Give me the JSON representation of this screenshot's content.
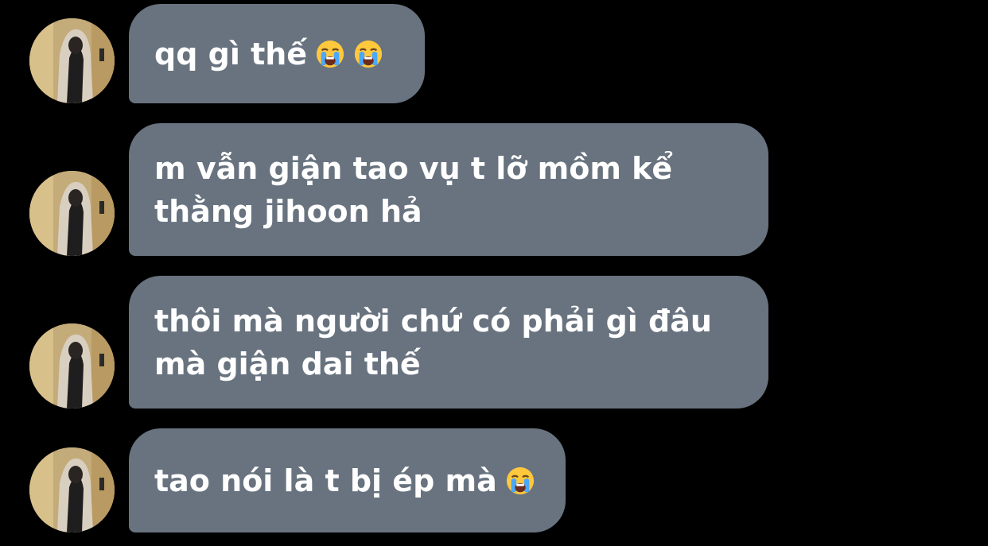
{
  "conversation": {
    "messages": [
      {
        "text": "qq gì thế",
        "emoji": [
          "loudly-crying-face-icon",
          "loudly-crying-face-icon"
        ]
      },
      {
        "text": "m vẫn giận tao vụ t lỡ mồm kể\nthằng jihoon hả",
        "emoji": []
      },
      {
        "text": "thôi mà người chứ có phải gì đâu\nmà giận dai thế",
        "emoji": []
      },
      {
        "text": "tao nói là t bị ép mà",
        "emoji": [
          "loudly-crying-face-icon"
        ]
      }
    ]
  },
  "colors": {
    "background": "#000000",
    "bubble": "#68737f",
    "text": "#ffffff"
  }
}
